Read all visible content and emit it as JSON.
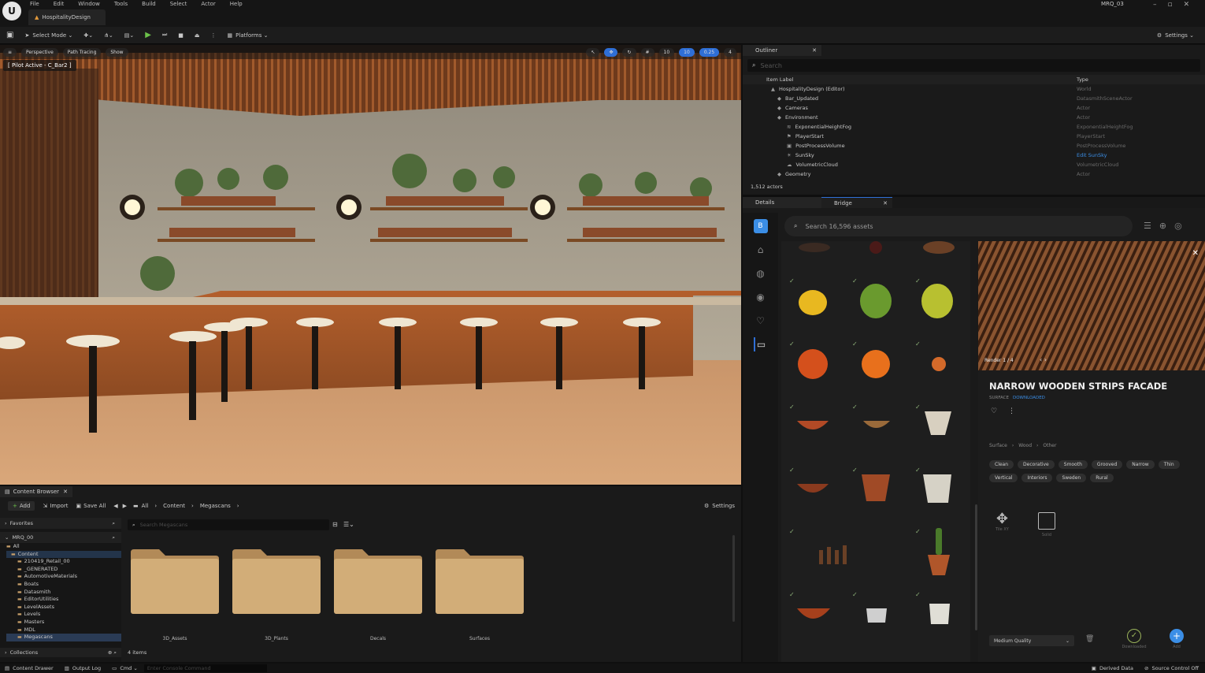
{
  "menubar": {
    "items": [
      "File",
      "Edit",
      "Window",
      "Tools",
      "Build",
      "Select",
      "Actor",
      "Help"
    ],
    "tab": "HospitalityDesign",
    "project": "MRQ_03"
  },
  "toolbar": {
    "select_mode": "Select Mode",
    "platforms": "Platforms",
    "settings": "Settings"
  },
  "viewport": {
    "perspective": "Perspective",
    "path_tracing": "Path Tracing",
    "show": "Show",
    "pilot": "[ Pilot Active - C_Bar2 ]",
    "stats": [
      "10",
      "10",
      "0.25",
      "4"
    ]
  },
  "outliner": {
    "tab": "Outliner",
    "search_placeholder": "Search",
    "col_label": "Item Label",
    "col_type": "Type",
    "rows": [
      {
        "label": "HospitalityDesign (Editor)",
        "type": "World"
      },
      {
        "label": "Bar_Updated",
        "type": "DatasmithSceneActor"
      },
      {
        "label": "Cameras",
        "type": "Actor"
      },
      {
        "label": "Environment",
        "type": "Actor"
      },
      {
        "label": "ExponentialHeightFog",
        "type": "ExponentialHeightFog"
      },
      {
        "label": "PlayerStart",
        "type": "PlayerStart"
      },
      {
        "label": "PostProcessVolume",
        "type": "PostProcessVolume"
      },
      {
        "label": "SunSky",
        "type": "Edit SunSky"
      },
      {
        "label": "VolumetricCloud",
        "type": "VolumetricCloud"
      },
      {
        "label": "Geometry",
        "type": "Actor"
      }
    ],
    "count": "1,512 actors"
  },
  "bridge": {
    "tab_details": "Details",
    "tab_bridge": "Bridge",
    "search_placeholder": "Search 16,596 assets",
    "render_label": "Render 1 / 4",
    "asset_title": "NARROW WOODEN STRIPS FACADE",
    "asset_subtitle": "SURFACE",
    "asset_status": "DOWNLOADED",
    "breadcrumb": [
      "Surface",
      "Wood",
      "Other"
    ],
    "tags": [
      "Clean",
      "Decorative",
      "Smooth",
      "Grooved",
      "Narrow",
      "Thin",
      "Vertical",
      "Interiors",
      "Sweden",
      "Rural"
    ],
    "tool1": "Tile XY",
    "tool2": "Solid",
    "quality": "Medium Quality",
    "downloaded": "Downloaded",
    "add": "Add"
  },
  "content_browser": {
    "tab": "Content Browser",
    "add": "Add",
    "import": "Import",
    "save_all": "Save All",
    "path": [
      "All",
      "Content",
      "Megascans"
    ],
    "settings": "Settings",
    "favorites": "Favorites",
    "project": "MRQ_00",
    "search_placeholder": "Search Megascans",
    "tree": [
      "All",
      "Content",
      "210419_Retail_00",
      "_GENERATED",
      "AutomotiveMaterials",
      "Boats",
      "Datasmith",
      "EditorUtilities",
      "LevelAssets",
      "Levels",
      "Masters",
      "MDL",
      "Megascans"
    ],
    "collections": "Collections",
    "folders": [
      "3D_Assets",
      "3D_Plants",
      "Decals",
      "Surfaces"
    ],
    "items_count": "4 items"
  },
  "statusbar": {
    "content_drawer": "Content Drawer",
    "output_log": "Output Log",
    "cmd": "Cmd",
    "cmd_placeholder": "Enter Console Command",
    "derived": "Derived Data",
    "source": "Source Control Off"
  }
}
